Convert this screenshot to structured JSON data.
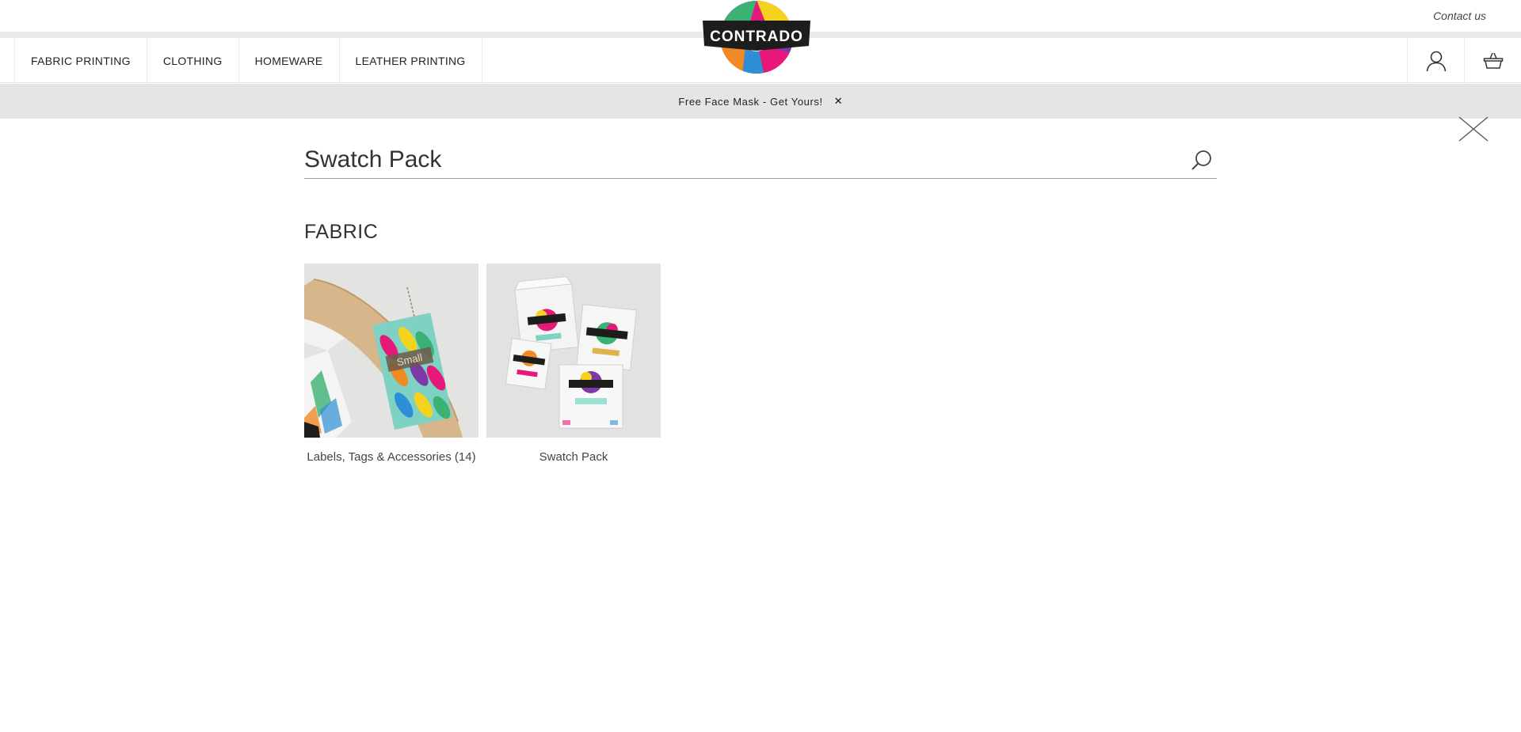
{
  "header": {
    "contact_label": "Contact us",
    "logo_text": "CONTRADO"
  },
  "nav": {
    "items": [
      {
        "label": "FABRIC PRINTING"
      },
      {
        "label": "CLOTHING"
      },
      {
        "label": "HOMEWARE"
      },
      {
        "label": "LEATHER PRINTING"
      }
    ],
    "icons": [
      "user-icon",
      "basket-icon"
    ]
  },
  "promo": {
    "text": "Free Face Mask - Get Yours!",
    "close_symbol": "✕"
  },
  "search": {
    "value": "Swatch Pack",
    "placeholder": ""
  },
  "results": {
    "section_title": "FABRIC",
    "items": [
      {
        "label": "Labels, Tags & Accessories (14)",
        "tag_text": "Small"
      },
      {
        "label": "Swatch Pack"
      }
    ]
  },
  "colors": {
    "promo_bg": "#e5e5e5",
    "brand_black": "#1d1d1b",
    "brand_pink": "#e6197b",
    "brand_yellow": "#f4d21e",
    "brand_green": "#3bb273",
    "brand_orange": "#f08a24"
  }
}
